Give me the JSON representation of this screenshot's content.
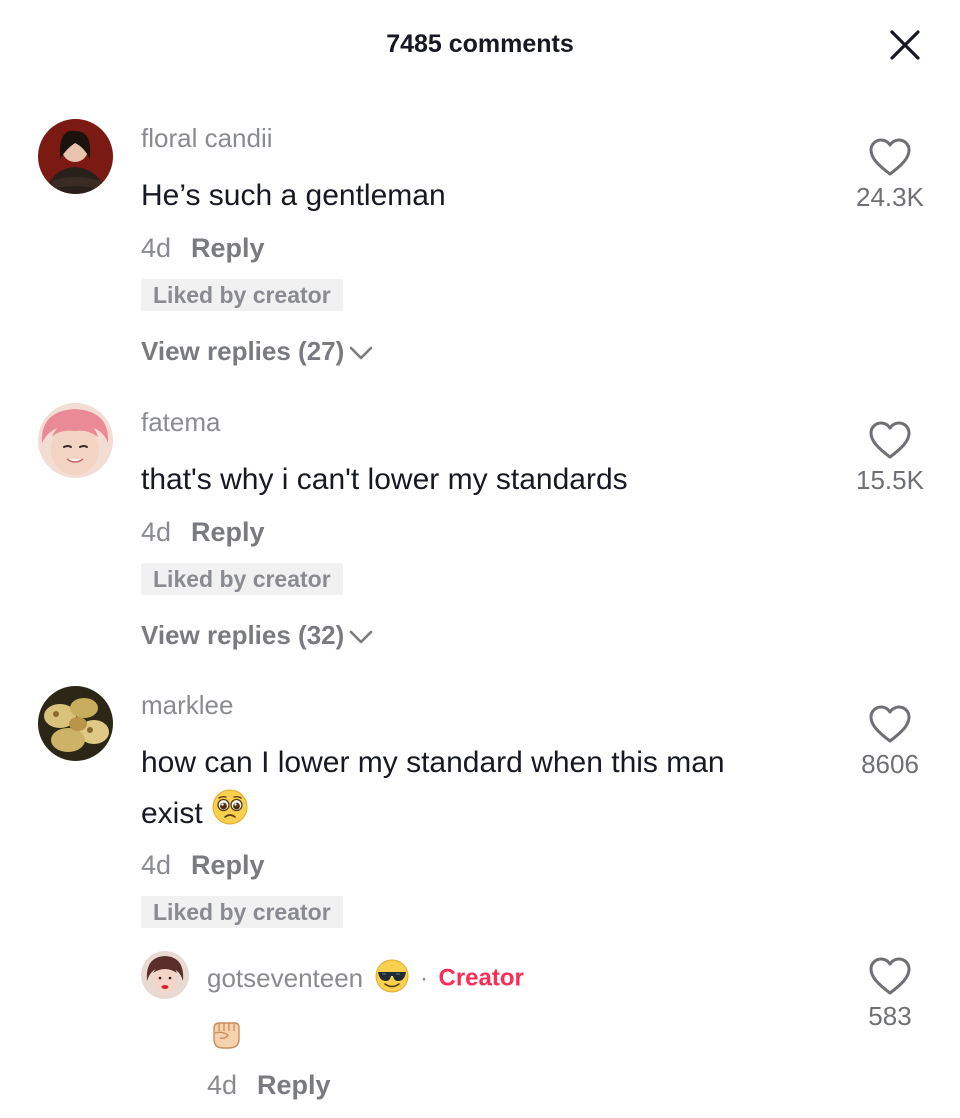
{
  "header": {
    "title": "7485 comments"
  },
  "comments": [
    {
      "username": "floral candii",
      "text": "He’s such a gentleman",
      "time": "4d",
      "reply_label": "Reply",
      "badge": "Liked by creator",
      "view_replies": "View replies (27)",
      "likes": "24.3K"
    },
    {
      "username": "fatema",
      "text": "that's why i can't lower my standards",
      "time": "4d",
      "reply_label": "Reply",
      "badge": "Liked by creator",
      "view_replies": "View replies (32)",
      "likes": "15.5K"
    },
    {
      "username": "marklee",
      "text_line1": "how can I lower my standard when this man",
      "text_line2": "exist",
      "time": "4d",
      "reply_label": "Reply",
      "badge": "Liked by creator",
      "likes": "8606",
      "emoji": "pleading-face"
    }
  ],
  "reply": {
    "username": "gotseventeen",
    "username_emoji": "sunglasses-face",
    "separator": "·",
    "creator_label": "Creator",
    "text_emoji": "raised-fist",
    "time": "4d",
    "reply_label": "Reply",
    "likes": "583"
  },
  "colors": {
    "accent": "#fe2c55",
    "secondary_text": "#8a8b91",
    "primary_text": "#161823"
  }
}
